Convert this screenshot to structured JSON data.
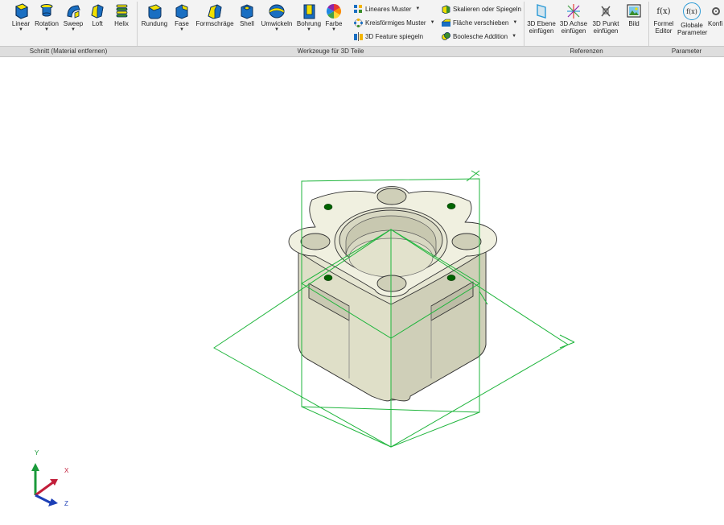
{
  "ribbon": {
    "groups": [
      {
        "label": "Schnitt (Material entfernen)"
      },
      {
        "label": "Werkzeuge für 3D Teile"
      },
      {
        "label": "Referenzen"
      },
      {
        "label": "Parameter"
      }
    ],
    "large_tools": [
      {
        "label": "Linear",
        "icon": "linear-extrude-icon",
        "dropdown": true
      },
      {
        "label": "Rotation",
        "icon": "rotation-icon",
        "dropdown": true
      },
      {
        "label": "Sweep",
        "icon": "sweep-icon",
        "dropdown": true
      },
      {
        "label": "Loft",
        "icon": "loft-icon",
        "dropdown": false
      },
      {
        "label": "Helix",
        "icon": "helix-icon",
        "dropdown": false
      },
      {
        "label": "Rundung",
        "icon": "fillet-icon",
        "dropdown": false
      },
      {
        "label": "Fase",
        "icon": "chamfer-icon",
        "dropdown": true
      },
      {
        "label": "Formschräge",
        "icon": "draft-icon",
        "dropdown": false
      },
      {
        "label": "Shell",
        "icon": "shell-icon",
        "dropdown": false
      },
      {
        "label": "Umwickeln",
        "icon": "wrap-icon",
        "dropdown": true
      },
      {
        "label": "Bohrung",
        "icon": "hole-icon",
        "dropdown": true
      },
      {
        "label": "Farbe",
        "icon": "color-wheel-icon",
        "dropdown": true
      }
    ],
    "small_tools_a": [
      {
        "label": "Lineares Muster",
        "icon": "linear-pattern-icon",
        "dropdown": true
      },
      {
        "label": "Kreisförmiges Muster",
        "icon": "circular-pattern-icon",
        "dropdown": true
      },
      {
        "label": "3D Feature spiegeln",
        "icon": "mirror-feature-icon",
        "dropdown": false
      }
    ],
    "small_tools_b": [
      {
        "label": "Skalieren oder Spiegeln",
        "icon": "scale-mirror-icon",
        "dropdown": false
      },
      {
        "label": "Fläche verschieben",
        "icon": "move-face-icon",
        "dropdown": true
      },
      {
        "label": "Boolesche Addition",
        "icon": "boolean-add-icon",
        "dropdown": true
      }
    ],
    "reference_tools": [
      {
        "line1": "3D Ebene",
        "line2": "einfügen",
        "icon": "plane-icon"
      },
      {
        "line1": "3D Achse",
        "line2": "einfügen",
        "icon": "axis-icon"
      },
      {
        "line1": "3D Punkt",
        "line2": "einfügen",
        "icon": "point-icon"
      },
      {
        "line1": "Bild",
        "line2": "",
        "icon": "image-icon"
      }
    ],
    "parameter_tools": [
      {
        "line1": "Formel",
        "line2": "Editor",
        "icon": "formula-icon",
        "glyph": "f(x)"
      },
      {
        "line1": "Globale",
        "line2": "Parameter",
        "icon": "global-parameter-icon",
        "glyph": "f(x)"
      },
      {
        "line1": "Konfi",
        "line2": "",
        "icon": "configuration-icon"
      }
    ]
  },
  "viewport": {
    "part_color": "#e6e6d2",
    "plane_color": "#1fb53c",
    "point_color": "#006400"
  },
  "axis_triad": {
    "x": "X",
    "y": "Y",
    "z": "Z",
    "x_color": "#c21e3a",
    "y_color": "#1a9a3a",
    "z_color": "#1c3fb6"
  }
}
